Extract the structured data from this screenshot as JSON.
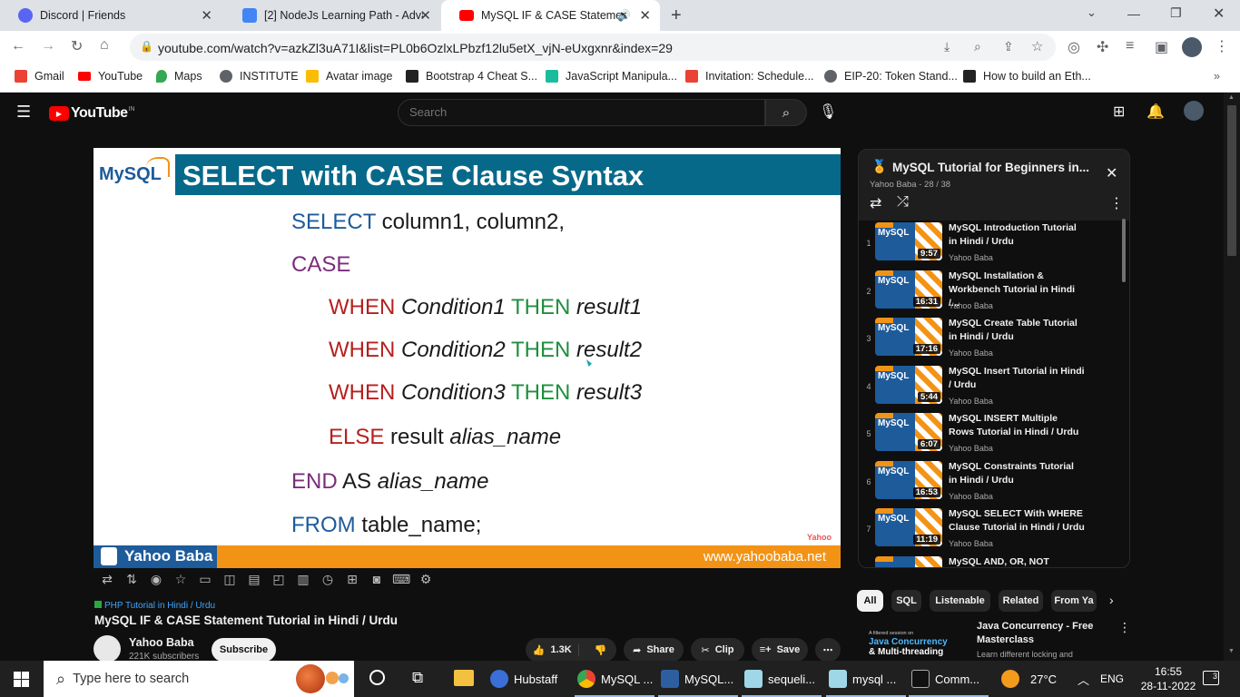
{
  "browser": {
    "tabs": [
      {
        "title": "Discord | Friends",
        "color": "#5865f2"
      },
      {
        "title": "[2] NodeJs Learning Path - Advan",
        "color": "#4285f4"
      },
      {
        "title": "MySQL IF & CASE Statement",
        "color": "#ff0000"
      }
    ],
    "url": "youtube.com/watch?v=azkZl3uA71I&list=PL0b6OzlxLPbzf12lu5etX_vjN-eUxgxnr&index=29",
    "bookmarks": [
      {
        "label": "Gmail",
        "color": "#ea4335"
      },
      {
        "label": "YouTube",
        "color": "#ff0000"
      },
      {
        "label": "Maps",
        "color": "#34a853"
      },
      {
        "label": "INSTITUTE",
        "color": "#5f6368"
      },
      {
        "label": "Avatar image",
        "color": "#fbbc04"
      },
      {
        "label": "Bootstrap 4 Cheat S...",
        "color": "#222222"
      },
      {
        "label": "JavaScript Manipula...",
        "color": "#1abc9c"
      },
      {
        "label": "Invitation: Schedule...",
        "color": "#ea4335"
      },
      {
        "label": "EIP-20: Token Stand...",
        "color": "#5f6368"
      },
      {
        "label": "How to build an Eth...",
        "color": "#222222"
      }
    ]
  },
  "youtube": {
    "logo": "YouTube",
    "region": "IN",
    "search_placeholder": "Search"
  },
  "video": {
    "slide_title": "SELECT with CASE Clause Syntax",
    "logo_text": "MySQL",
    "lines": {
      "select_kw": "SELECT",
      "select_cols": " column1, column2,",
      "case_kw": "CASE",
      "when": "WHEN",
      "then": "THEN",
      "cond1": "Condition1",
      "cond2": "Condition2",
      "cond3": "Condition3",
      "res1": "result1",
      "res2": "result2",
      "res3": "result3",
      "else_kw": "ELSE",
      "else_rest": " result ",
      "alias": "alias_name",
      "end_kw": "END",
      "as_text": " AS ",
      "from_kw": "FROM",
      "table": " table_name;"
    },
    "channel_banner": "Yahoo Baba",
    "watermark": "Yahoo",
    "site_url": "www.yahoobaba.net"
  },
  "meta": {
    "playlist_tag": "PHP Tutorial in Hindi / Urdu",
    "title": "MySQL IF & CASE Statement Tutorial in Hindi / Urdu",
    "channel": "Yahoo Baba",
    "subscribers": "221K subscribers",
    "subscribe": "Subscribe",
    "likes": "1.3K",
    "share": "Share",
    "clip": "Clip",
    "save": "Save"
  },
  "playlist": {
    "title": "MySQL Tutorial for Beginners in...",
    "subtitle": "Yahoo Baba - 28 / 38",
    "items": [
      {
        "num": "1",
        "title": "MySQL Introduction Tutorial in Hindi / Urdu",
        "channel": "Yahoo Baba",
        "duration": "9:57"
      },
      {
        "num": "2",
        "title": "MySQL Installation & Workbench Tutorial in Hindi /...",
        "channel": "Yahoo Baba",
        "duration": "16:31"
      },
      {
        "num": "3",
        "title": "MySQL Create Table Tutorial in Hindi / Urdu",
        "channel": "Yahoo Baba",
        "duration": "17:16"
      },
      {
        "num": "4",
        "title": "MySQL Insert Tutorial in Hindi / Urdu",
        "channel": "Yahoo Baba",
        "duration": "5:44"
      },
      {
        "num": "5",
        "title": "MySQL INSERT Multiple Rows Tutorial in Hindi / Urdu",
        "channel": "Yahoo Baba",
        "duration": "6:07"
      },
      {
        "num": "6",
        "title": "MySQL Constraints Tutorial in Hindi / Urdu",
        "channel": "Yahoo Baba",
        "duration": "16:53"
      },
      {
        "num": "7",
        "title": "MySQL SELECT With WHERE Clause Tutorial in Hindi / Urdu",
        "channel": "Yahoo Baba",
        "duration": "11:19"
      },
      {
        "num": "",
        "title": "MySQL AND, OR, NOT",
        "channel": "",
        "duration": ""
      }
    ]
  },
  "chips": [
    "All",
    "SQL",
    "Listenable",
    "Related",
    "From Ya"
  ],
  "recommendation": {
    "title": "Java Concurrency - Free Masterclass",
    "desc": "Learn different locking and",
    "thumb_top": "A filtered session on",
    "thumb_main": "Java Concurrency",
    "thumb_sub": "& Multi-threading"
  },
  "taskbar": {
    "search": "Type here to search",
    "apps": [
      {
        "label": "Hubstaff"
      },
      {
        "label": "MySQL ..."
      },
      {
        "label": "MySQL..."
      },
      {
        "label": "sequeli..."
      },
      {
        "label": "mysql ..."
      },
      {
        "label": "Comm..."
      }
    ],
    "weather": "27°C",
    "lang": "ENG",
    "time": "16:55",
    "date": "28-11-2022",
    "notif": "3"
  }
}
